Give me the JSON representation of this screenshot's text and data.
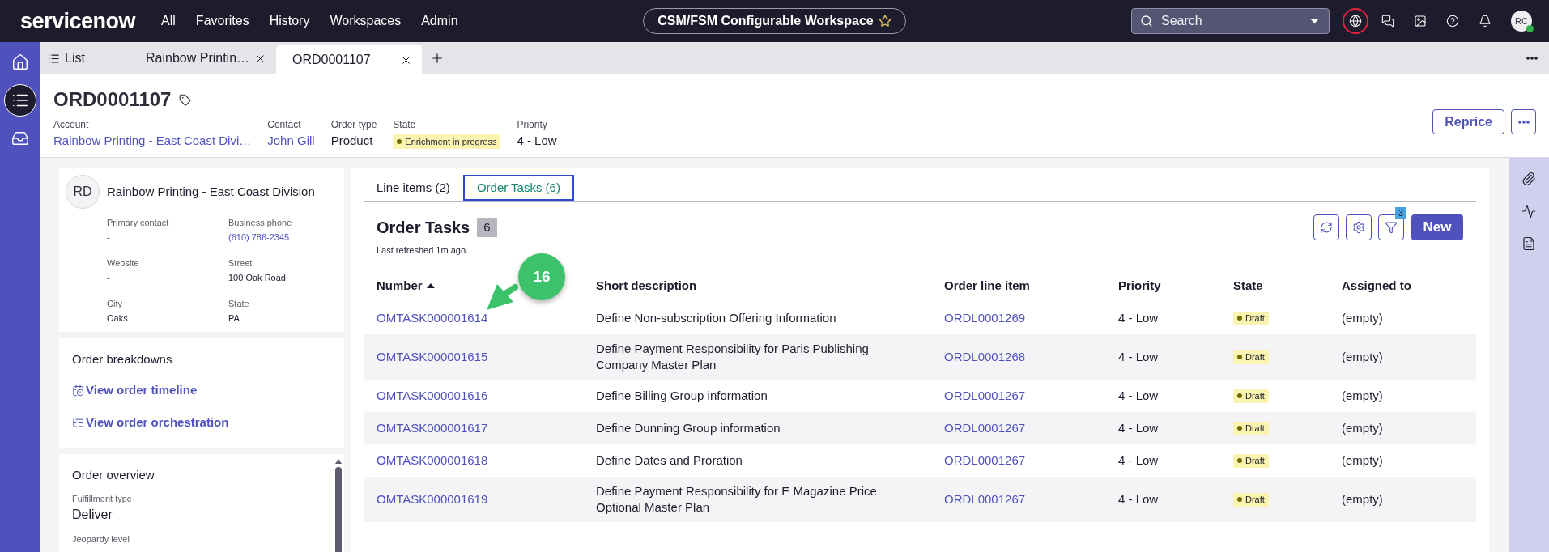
{
  "top_nav": {
    "logo": "servicenow",
    "menu": [
      "All",
      "Favorites",
      "History",
      "Workspaces",
      "Admin"
    ],
    "workspace": {
      "label": "CSM/FSM Configurable Workspace",
      "favorite": false
    },
    "search": {
      "placeholder": "Search"
    },
    "avatar": {
      "initials": "RC",
      "online": true
    }
  },
  "rail": [
    {
      "selected": false
    },
    {
      "selected": true
    },
    {
      "selected": false
    }
  ],
  "tabs": [
    {
      "label": "List",
      "kind": "list",
      "closable": false,
      "selected": false
    },
    {
      "label": "Rainbow Printin…",
      "kind": "record",
      "closable": true,
      "selected": false
    },
    {
      "label": "ORD0001107",
      "kind": "record",
      "closable": true,
      "selected": true
    }
  ],
  "record": {
    "title": "ORD0001107",
    "fields": [
      {
        "label": "Account",
        "value": "Rainbow Printing - East Coast Divi…",
        "kind": "link"
      },
      {
        "label": "Contact",
        "value": "John Gill",
        "kind": "link"
      },
      {
        "label": "Order type",
        "value": "Product",
        "kind": "text"
      },
      {
        "label": "State",
        "value": "Enrichment in progress",
        "kind": "badge"
      },
      {
        "label": "Priority",
        "value": "4 - Low",
        "kind": "text"
      }
    ],
    "actions": [
      {
        "label": "Reprice"
      }
    ]
  },
  "account": {
    "initials": "RD",
    "name": "Rainbow Printing - East Coast Division",
    "fields": [
      {
        "label": "Primary contact",
        "value": "-",
        "kind": "text"
      },
      {
        "label": "Business phone",
        "value": "(610) 786-2345",
        "kind": "link"
      },
      {
        "label": "Website",
        "value": "-",
        "kind": "text"
      },
      {
        "label": "Street",
        "value": "100 Oak Road",
        "kind": "text"
      },
      {
        "label": "City",
        "value": "Oaks",
        "kind": "text"
      },
      {
        "label": "State",
        "value": "PA",
        "kind": "text"
      }
    ]
  },
  "breakdowns": {
    "title": "Order breakdowns",
    "links": [
      {
        "label": "View order timeline",
        "kind": "timeline"
      },
      {
        "label": "View order orchestration",
        "kind": "orchestration"
      }
    ]
  },
  "overview": {
    "title": "Order overview",
    "fields": [
      {
        "label": "Fulfillment type",
        "value": "Deliver"
      },
      {
        "label": "Jeopardy level"
      }
    ]
  },
  "record_tabs": [
    {
      "label": "Line items (2)",
      "selected": false
    },
    {
      "label": "Order Tasks (6)",
      "selected": true
    }
  ],
  "related_list": {
    "title": "Order Tasks",
    "count": "6",
    "refreshed": "Last refreshed 1m ago.",
    "filter_badge": "3",
    "new_button": "New",
    "columns": [
      {
        "label": "Number",
        "kind": "link",
        "sorted": true
      },
      {
        "label": "Short description",
        "kind": "text",
        "sorted": false
      },
      {
        "label": "Order line item",
        "kind": "link",
        "sorted": false
      },
      {
        "label": "Priority",
        "kind": "text",
        "sorted": false
      },
      {
        "label": "State",
        "kind": "badge",
        "sorted": false
      },
      {
        "label": "Assigned to",
        "kind": "text",
        "sorted": false
      }
    ],
    "rows": [
      {
        "cells": [
          "OMTASK000001614",
          "Define Non-subscription Offering Information",
          "ORDL0001269",
          "4 - Low",
          "Draft",
          "(empty)"
        ]
      },
      {
        "cells": [
          "OMTASK000001615",
          "Define Payment Responsibility for Paris Publishing Company Master Plan",
          "ORDL0001268",
          "4 - Low",
          "Draft",
          "(empty)"
        ]
      },
      {
        "cells": [
          "OMTASK000001616",
          "Define Billing Group information",
          "ORDL0001267",
          "4 - Low",
          "Draft",
          "(empty)"
        ]
      },
      {
        "cells": [
          "OMTASK000001617",
          "Define Dunning Group information",
          "ORDL0001267",
          "4 - Low",
          "Draft",
          "(empty)"
        ]
      },
      {
        "cells": [
          "OMTASK000001618",
          "Define Dates and Proration",
          "ORDL0001267",
          "4 - Low",
          "Draft",
          "(empty)"
        ]
      },
      {
        "cells": [
          "OMTASK000001619",
          "Define Payment Responsibility for E Magazine Price Optional Master Plan",
          "ORDL0001267",
          "4 - Low",
          "Draft",
          "(empty)"
        ]
      }
    ]
  },
  "callout": {
    "label": "16"
  }
}
